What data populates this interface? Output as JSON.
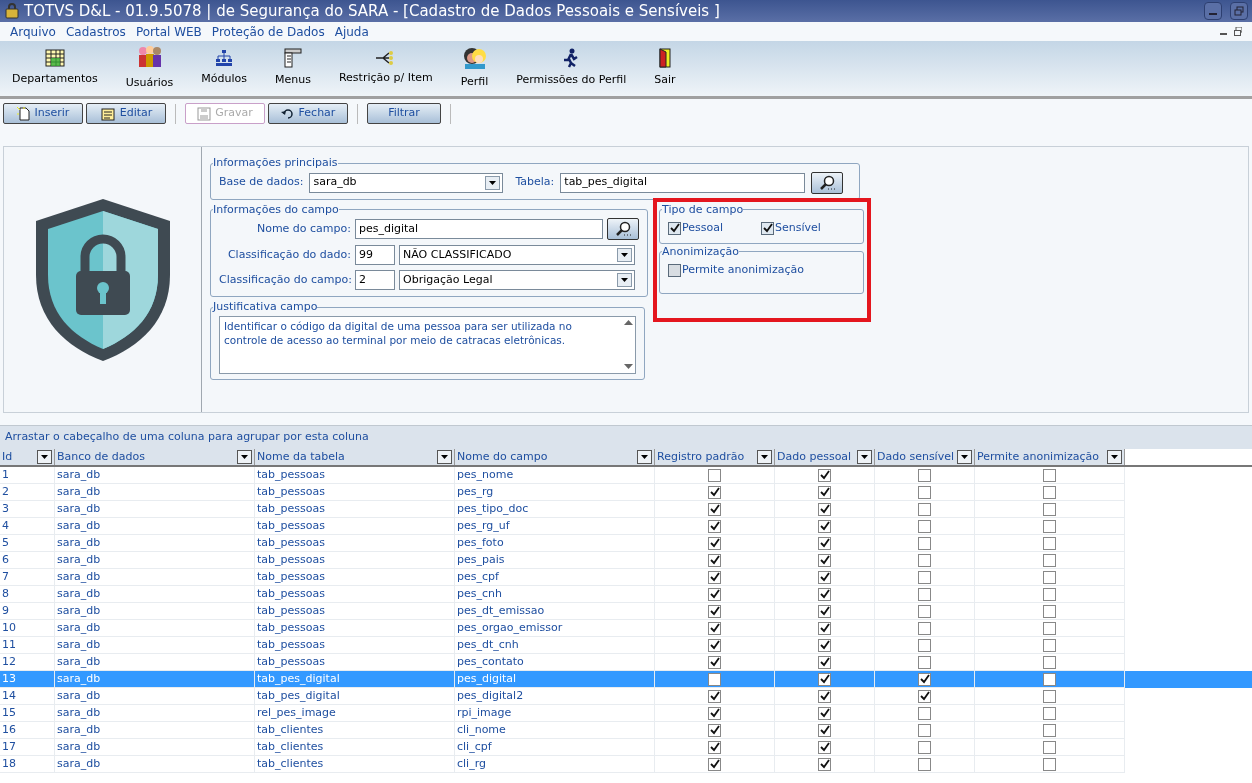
{
  "window": {
    "title": "TOTVS D&L - 01.9.5078 | de Segurança do SARA - [Cadastro de Dados Pessoais e Sensíveis ]"
  },
  "menu": [
    "Arquivo",
    "Cadastros",
    "Portal WEB",
    "Proteção de Dados",
    "Ajuda"
  ],
  "toolbar": [
    "Departamentos",
    "Usuários",
    "Módulos",
    "Menus",
    "Restrição p/ Item",
    "Perfil",
    "Permissões do Perfil",
    "Sair"
  ],
  "actions": [
    {
      "label": "Inserir",
      "disabled": false
    },
    {
      "label": "Editar",
      "disabled": false
    },
    {
      "label": "Gravar",
      "disabled": true
    },
    {
      "label": "Fechar",
      "disabled": false
    },
    {
      "label": "Filtrar",
      "disabled": false
    }
  ],
  "main_info": {
    "legend": "Informações principais",
    "database_label": "Base de dados:",
    "database_value": "sara_db",
    "table_label": "Tabela:",
    "table_value": "tab_pes_digital"
  },
  "field_info": {
    "legend": "Informações do campo",
    "name_label": "Nome do campo:",
    "name_value": "pes_digital",
    "data_class_label": "Classificação do dado:",
    "data_class_code": "99",
    "data_class_value": "NÃO CLASSIFICADO",
    "field_class_label": "Classificação do campo:",
    "field_class_code": "2",
    "field_class_value": "Obrigação Legal"
  },
  "justification": {
    "legend": "Justificativa campo",
    "text": "Identificar o código da digital de uma pessoa para ser utilizada no controle de acesso ao terminal por meio de catracas eletrônicas."
  },
  "field_type": {
    "legend": "Tipo de campo",
    "options": [
      {
        "label": "Pessoal",
        "checked": true
      },
      {
        "label": "Sensível",
        "checked": true
      }
    ]
  },
  "anonymization": {
    "legend": "Anonimização",
    "options": [
      {
        "label": "Permite anonimização",
        "checked": false
      }
    ]
  },
  "grid": {
    "group_hint": "Arrastar o cabeçalho de uma coluna para agrupar por esta coluna",
    "columns": [
      "Id",
      "Banco de dados",
      "Nome da tabela",
      "Nome do campo",
      "Registro padrão",
      "Dado pessoal",
      "Dado sensível",
      "Permite anonimização"
    ],
    "rows": [
      {
        "cells": [
          "1",
          "sara_db",
          "tab_pessoas",
          "pes_nome"
        ],
        "flags": [
          false,
          true,
          false,
          false
        ],
        "selected": false
      },
      {
        "cells": [
          "2",
          "sara_db",
          "tab_pessoas",
          "pes_rg"
        ],
        "flags": [
          true,
          true,
          false,
          false
        ],
        "selected": false
      },
      {
        "cells": [
          "3",
          "sara_db",
          "tab_pessoas",
          "pes_tipo_doc"
        ],
        "flags": [
          true,
          true,
          false,
          false
        ],
        "selected": false
      },
      {
        "cells": [
          "4",
          "sara_db",
          "tab_pessoas",
          "pes_rg_uf"
        ],
        "flags": [
          true,
          true,
          false,
          false
        ],
        "selected": false
      },
      {
        "cells": [
          "5",
          "sara_db",
          "tab_pessoas",
          "pes_foto"
        ],
        "flags": [
          true,
          true,
          false,
          false
        ],
        "selected": false
      },
      {
        "cells": [
          "6",
          "sara_db",
          "tab_pessoas",
          "pes_pais"
        ],
        "flags": [
          true,
          true,
          false,
          false
        ],
        "selected": false
      },
      {
        "cells": [
          "7",
          "sara_db",
          "tab_pessoas",
          "pes_cpf"
        ],
        "flags": [
          true,
          true,
          false,
          false
        ],
        "selected": false
      },
      {
        "cells": [
          "8",
          "sara_db",
          "tab_pessoas",
          "pes_cnh"
        ],
        "flags": [
          true,
          true,
          false,
          false
        ],
        "selected": false
      },
      {
        "cells": [
          "9",
          "sara_db",
          "tab_pessoas",
          "pes_dt_emissao"
        ],
        "flags": [
          true,
          true,
          false,
          false
        ],
        "selected": false
      },
      {
        "cells": [
          "10",
          "sara_db",
          "tab_pessoas",
          "pes_orgao_emissor"
        ],
        "flags": [
          true,
          true,
          false,
          false
        ],
        "selected": false
      },
      {
        "cells": [
          "11",
          "sara_db",
          "tab_pessoas",
          "pes_dt_cnh"
        ],
        "flags": [
          true,
          true,
          false,
          false
        ],
        "selected": false
      },
      {
        "cells": [
          "12",
          "sara_db",
          "tab_pessoas",
          "pes_contato"
        ],
        "flags": [
          true,
          true,
          false,
          false
        ],
        "selected": false
      },
      {
        "cells": [
          "13",
          "sara_db",
          "tab_pes_digital",
          "pes_digital"
        ],
        "flags": [
          false,
          true,
          true,
          false
        ],
        "selected": true
      },
      {
        "cells": [
          "14",
          "sara_db",
          "tab_pes_digital",
          "pes_digital2"
        ],
        "flags": [
          true,
          true,
          true,
          false
        ],
        "selected": false
      },
      {
        "cells": [
          "15",
          "sara_db",
          "rel_pes_image",
          "rpi_image"
        ],
        "flags": [
          true,
          true,
          false,
          false
        ],
        "selected": false
      },
      {
        "cells": [
          "16",
          "sara_db",
          "tab_clientes",
          "cli_nome"
        ],
        "flags": [
          true,
          true,
          false,
          false
        ],
        "selected": false
      },
      {
        "cells": [
          "17",
          "sara_db",
          "tab_clientes",
          "cli_cpf"
        ],
        "flags": [
          true,
          true,
          false,
          false
        ],
        "selected": false
      },
      {
        "cells": [
          "18",
          "sara_db",
          "tab_clientes",
          "cli_rg"
        ],
        "flags": [
          true,
          true,
          false,
          false
        ],
        "selected": false
      }
    ]
  }
}
